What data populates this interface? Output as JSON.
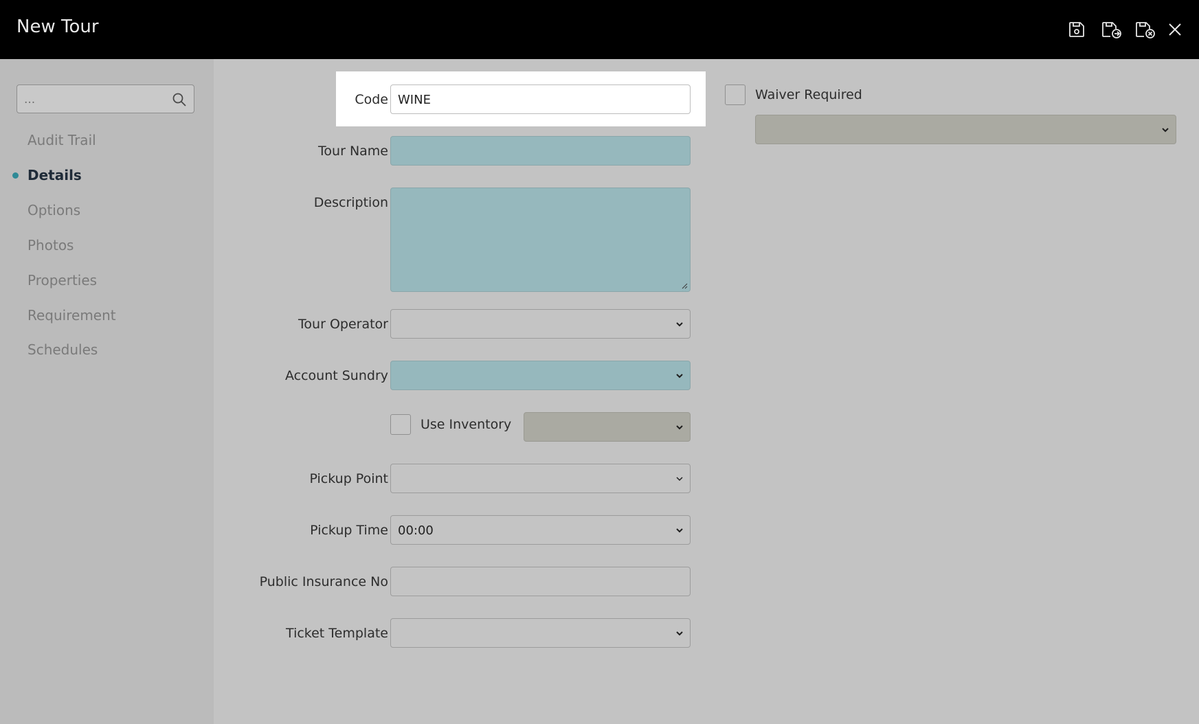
{
  "window": {
    "title": "New Tour"
  },
  "toolbar": {
    "save_icon": "save-icon",
    "save_new_icon": "save-and-new-icon",
    "save_close_icon": "save-and-close-icon",
    "close_icon": "close-icon"
  },
  "sidebar": {
    "search_placeholder": "...",
    "items": [
      {
        "label": "Audit Trail"
      },
      {
        "label": "Details"
      },
      {
        "label": "Options"
      },
      {
        "label": "Photos"
      },
      {
        "label": "Properties"
      },
      {
        "label": "Requirement"
      },
      {
        "label": "Schedules"
      }
    ]
  },
  "form": {
    "code": {
      "label": "Code",
      "value": "WINE"
    },
    "tour_name": {
      "label": "Tour Name",
      "value": ""
    },
    "description": {
      "label": "Description",
      "value": ""
    },
    "tour_operator": {
      "label": "Tour Operator",
      "value": ""
    },
    "account_sundry": {
      "label": "Account Sundry",
      "value": ""
    },
    "use_inventory": {
      "label": "Use Inventory",
      "checked": false
    },
    "pickup_point": {
      "label": "Pickup Point",
      "value": ""
    },
    "pickup_time": {
      "label": "Pickup Time",
      "value": "00:00"
    },
    "public_insurance_no": {
      "label": "Public Insurance No",
      "value": ""
    },
    "ticket_template": {
      "label": "Ticket Template",
      "value": ""
    },
    "waiver_required": {
      "label": "Waiver Required",
      "checked": false
    }
  },
  "colors": {
    "titlebar": "#000000",
    "required_field": "#96b8bd",
    "active_dot": "#2f8a96"
  }
}
